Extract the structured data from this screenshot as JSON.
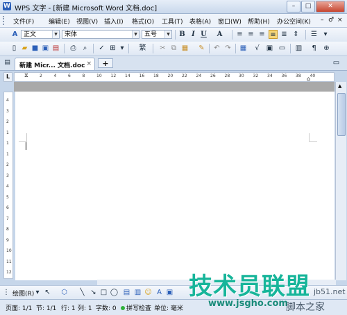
{
  "window": {
    "title": "WPS 文字 - [新建 Microsoft Word 文档.doc]",
    "app_icon": "W"
  },
  "window_controls": {
    "minimize": "–",
    "maximize": "□",
    "close": "✕"
  },
  "menu": {
    "items": [
      "文件(F)",
      "编辑(E)",
      "视图(V)",
      "插入(I)",
      "格式(O)",
      "工具(T)",
      "表格(A)",
      "窗口(W)",
      "帮助(H)",
      "办公空间(K)"
    ],
    "right_controls": [
      "–",
      "♂",
      "×"
    ]
  },
  "format_toolbar": {
    "style": "正文",
    "font": "宋体",
    "size": "五号",
    "bold": "B",
    "italic": "I",
    "underline": "U",
    "font_color": "A"
  },
  "tabs": [
    {
      "label": "新建 Micr... 文档.doc",
      "close": "×"
    }
  ],
  "new_tab": "+",
  "ruler": {
    "corner": "L",
    "h_numbers": [
      "2",
      "4",
      "6",
      "8",
      "10",
      "12",
      "14",
      "16",
      "18",
      "20",
      "22",
      "24",
      "26",
      "28",
      "30",
      "32",
      "34",
      "36",
      "38",
      "40"
    ],
    "v_numbers": [
      "4",
      "3",
      "2",
      "1",
      "1",
      "1",
      "2",
      "3",
      "4",
      "5",
      "6",
      "7",
      "8",
      "9",
      "10",
      "11",
      "12"
    ]
  },
  "drawing_toolbar": {
    "draw_label": "绘图(R)"
  },
  "status": {
    "page": "页面: 1/1",
    "section": "节: 1/1",
    "line": "行: 1",
    "column": "列: 1",
    "words": "字数: 0",
    "spell": "拼写检查",
    "unit": "单位: 毫米"
  },
  "watermark": {
    "main": "技术员联盟",
    "url": "www.jsgho.com",
    "site1": "jb51.net",
    "site2": "脚本之家"
  }
}
